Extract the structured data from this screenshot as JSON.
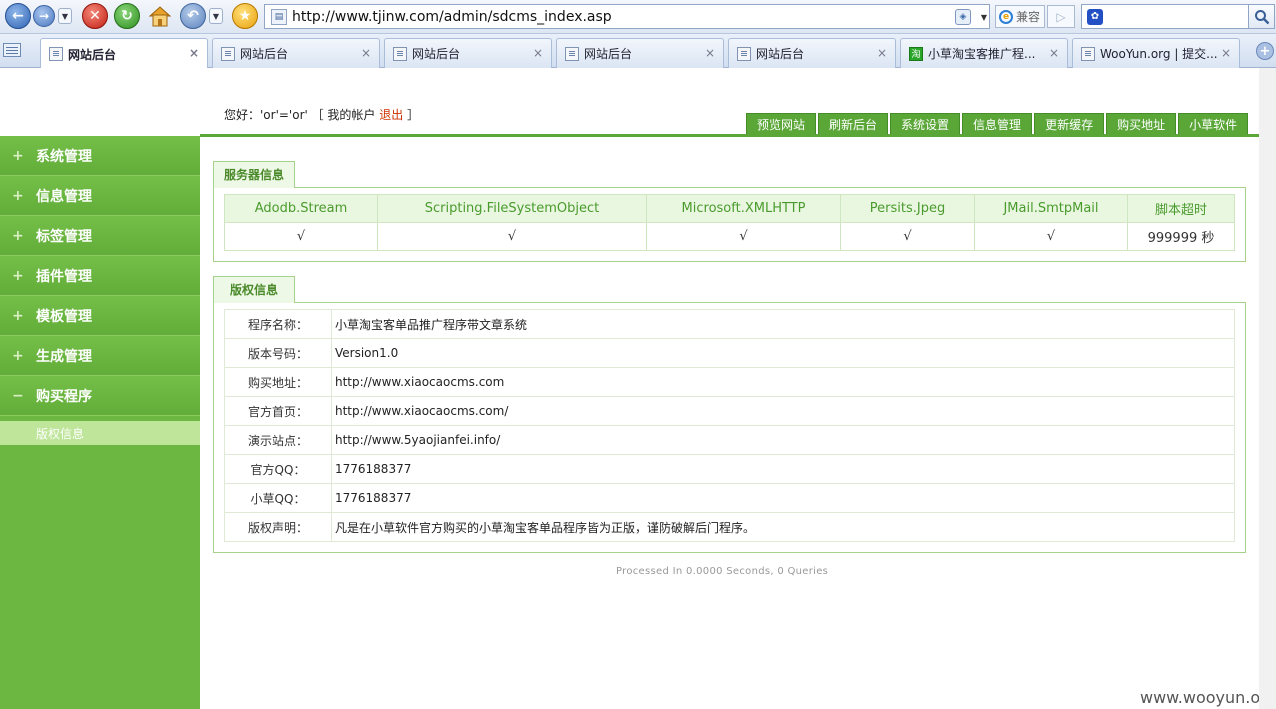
{
  "browser": {
    "url": "http://www.tjinw.com/admin/sdcms_index.asp",
    "compat_label": "兼容",
    "tabs": [
      {
        "label": "网站后台"
      },
      {
        "label": "网站后台"
      },
      {
        "label": "网站后台"
      },
      {
        "label": "网站后台"
      },
      {
        "label": "网站后台"
      },
      {
        "label": "小草淘宝客推广程..."
      },
      {
        "label": "WooYun.org | 提交..."
      }
    ],
    "tab_close": "×"
  },
  "header": {
    "greeting_prefix": "您好：'or'='or'  ［ 我的帐户 ",
    "logout": "退出",
    "greeting_suffix": " ］",
    "nav": [
      "预览网站",
      "刷新后台",
      "系统设置",
      "信息管理",
      "更新缓存",
      "购买地址",
      "小草软件"
    ]
  },
  "sidebar": {
    "items": [
      {
        "label": "系统管理",
        "icon": "+"
      },
      {
        "label": "信息管理",
        "icon": "+"
      },
      {
        "label": "标签管理",
        "icon": "+"
      },
      {
        "label": "插件管理",
        "icon": "+"
      },
      {
        "label": "模板管理",
        "icon": "+"
      },
      {
        "label": "生成管理",
        "icon": "+"
      },
      {
        "label": "购买程序",
        "icon": "−"
      }
    ],
    "sub": "版权信息"
  },
  "server": {
    "tab": "服务器信息",
    "headers": [
      "Adodb.Stream",
      "Scripting.FileSystemObject",
      "Microsoft.XMLHTTP",
      "Persits.Jpeg",
      "JMail.SmtpMail",
      "脚本超时"
    ],
    "values": [
      "√",
      "√",
      "√",
      "√",
      "√",
      "999999 秒"
    ]
  },
  "copyright": {
    "tab": "版权信息",
    "rows": [
      {
        "k": "程序名称：",
        "v": "小草淘宝客单品推广程序带文章系统"
      },
      {
        "k": "版本号码：",
        "v": "Version1.0"
      },
      {
        "k": "购买地址：",
        "v": "http://www.xiaocaocms.com"
      },
      {
        "k": "官方首页：",
        "v": "http://www.xiaocaocms.com/"
      },
      {
        "k": "演示站点：",
        "v": "http://www.5yaojianfei.info/"
      },
      {
        "k": "官方QQ：",
        "v": "1776188377"
      },
      {
        "k": "小草QQ：",
        "v": "1776188377"
      },
      {
        "k": "版权声明：",
        "v": "凡是在小草软件官方购买的小草淘宝客单品程序皆为正版，谨防破解后门程序。"
      }
    ]
  },
  "footer": "Processed In 0.0000 Seconds, 0 Queries",
  "watermark": "www.wooyun.org"
}
